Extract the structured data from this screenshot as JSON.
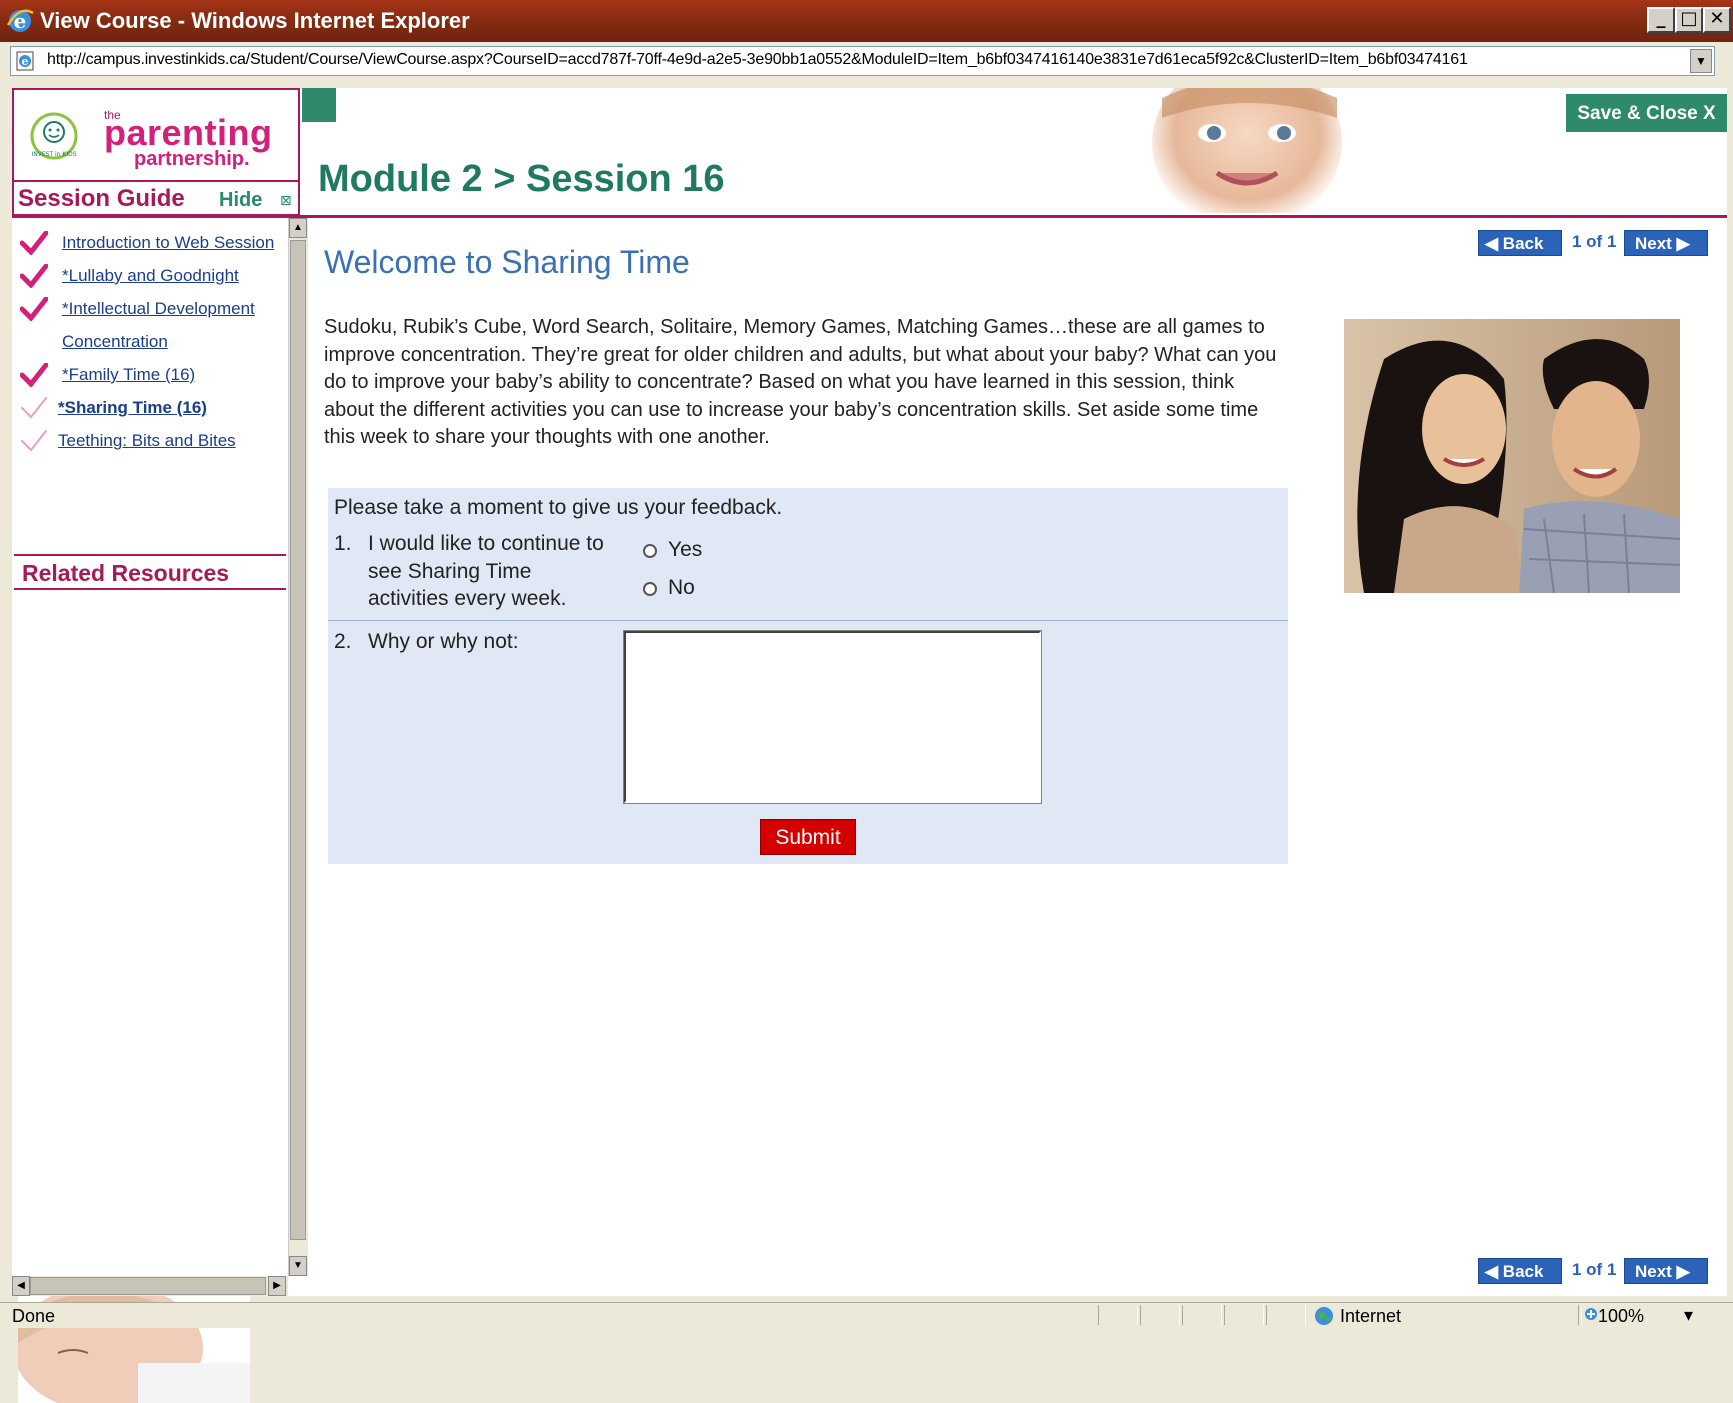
{
  "window": {
    "title": "View Course - Windows Internet Explorer",
    "minimize": "_",
    "maximize": "□",
    "close": "✕"
  },
  "address": {
    "url": "http://campus.investinkids.ca/Student/Course/ViewCourse.aspx?CourseID=accd787f-70ff-4e9d-a2e5-3e90bb1a0552&ModuleID=Item_b6bf0347416140e3831e7d61eca5f92c&ClusterID=Item_b6bf03474161"
  },
  "header": {
    "logo_the": "the",
    "logo_parenting": "parenting",
    "logo_partnership": "partnership.",
    "logo_seal_text": "INVEST in KIDS",
    "session_guide": "Session Guide",
    "hide": "Hide",
    "hide_icon": "⊠",
    "module_title": "Module 2 > Session 16",
    "save_close": "Save & Close  X"
  },
  "sidebar": {
    "items": [
      {
        "label": "Introduction to Web Session",
        "status": "complete"
      },
      {
        "label": "*Lullaby and Goodnight",
        "status": "complete"
      },
      {
        "label": "*Intellectual Development",
        "status": "complete"
      },
      {
        "label": "Concentration",
        "status": "complete"
      },
      {
        "label": "*Family Time (16)",
        "status": "complete"
      },
      {
        "label": "*Sharing Time (16)",
        "status": "current"
      },
      {
        "label": "Teething: Bits and Bites",
        "status": "incomplete"
      }
    ],
    "related_resources": "Related Resources"
  },
  "pager": {
    "back": "◀ Back",
    "info": "1 of 1",
    "next": "Next ▶"
  },
  "content": {
    "heading": "Welcome to Sharing Time",
    "paragraph": "Sudoku, Rubik’s Cube, Word Search, Solitaire, Memory Games, Matching Games…these are all games to improve concentration. They’re great for older children and adults, but what about your baby? What can you do to improve your baby’s ability to concentrate? Based on what you have learned in this session, think about the different activities you can use to increase your baby’s concentration skills. Set aside some time this week to share your thoughts with one another."
  },
  "feedback": {
    "intro": "Please take a moment to give us your feedback.",
    "q1_num": "1.",
    "q1_text": "I would like to continue to see Sharing Time activities every week.",
    "q1_options": [
      "Yes",
      "No"
    ],
    "q2_num": "2.",
    "q2_text": "Why or why not:",
    "q2_value": "",
    "submit": "Submit"
  },
  "status": {
    "text": "Done",
    "zone": "Internet",
    "zoom": "100%",
    "zoom_drop": "▾"
  },
  "colors": {
    "brand_pink": "#a8195a",
    "brand_green": "#2e8a6a",
    "heading_blue": "#3a70b5",
    "submit_red": "#d40000",
    "titlebar": "#8a2c12"
  }
}
